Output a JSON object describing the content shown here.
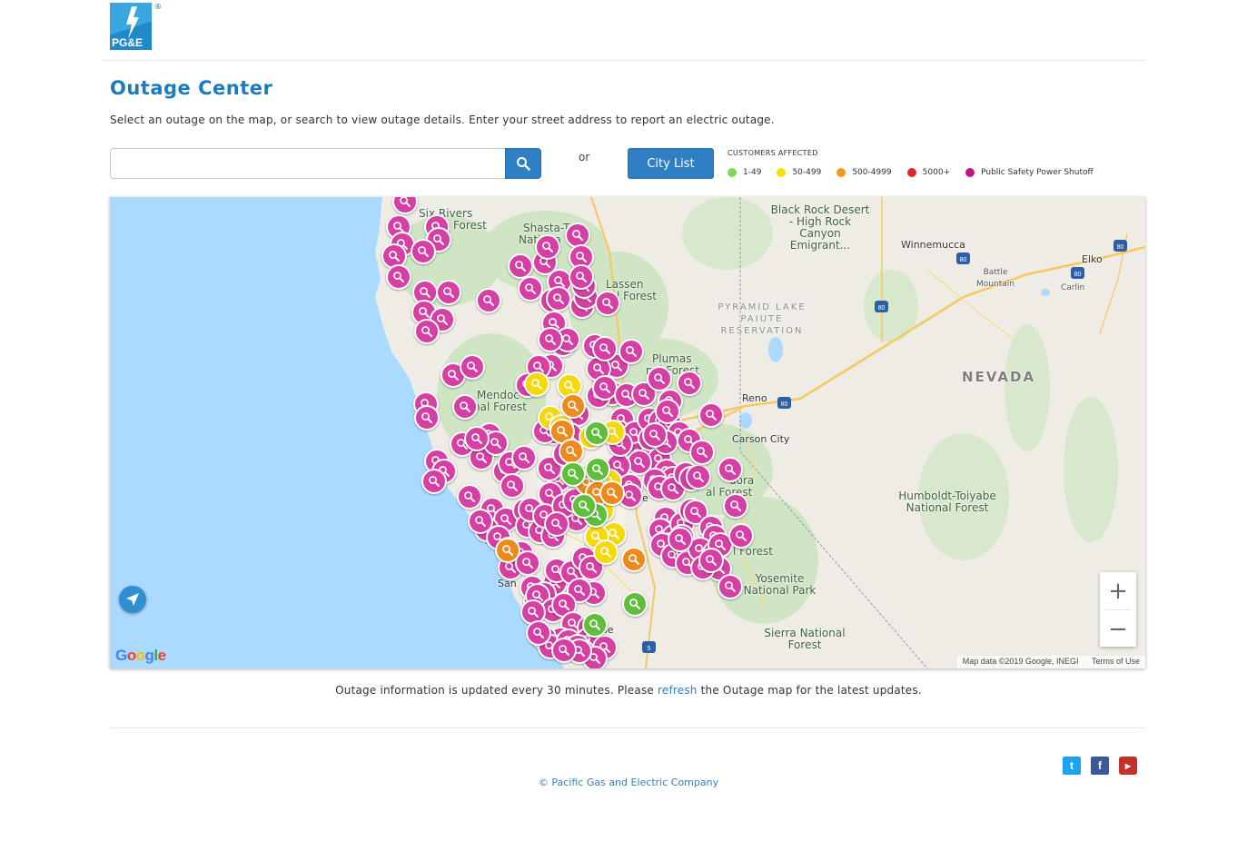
{
  "header": {
    "logo_text": "PG&E",
    "registered_mark": "®"
  },
  "page": {
    "title": "Outage Center",
    "intro": "Select an outage on the map, or search to view outage details. Enter your street address to report an electric outage."
  },
  "search": {
    "value": "",
    "placeholder": "",
    "or_label": "or",
    "city_list_label": "City List",
    "icon": "search-icon"
  },
  "legend": {
    "title": "CUSTOMERS AFFECTED",
    "items": [
      {
        "label": "1-49",
        "color": "#7ed957"
      },
      {
        "label": "50-499",
        "color": "#f5e003"
      },
      {
        "label": "500-4999",
        "color": "#f7941d"
      },
      {
        "label": "5000+",
        "color": "#e3262b"
      },
      {
        "label": "Public Safety Power Shutoff",
        "color": "#c6118b"
      }
    ]
  },
  "map": {
    "labels": {
      "six_rivers": "Six Rivers",
      "forest1": "Forest",
      "shasta": "Shasta-T",
      "national": "Nationa",
      "lassen": "Lassen",
      "lassen_forest": "nal Forest",
      "black_rock": "Black Rock Desert - High Rock Canyon Emigrant...",
      "winnemucca": "Winnemucca",
      "battle_mountain": "Battle Mountain",
      "elko": "Elko",
      "carlin": "Carlin",
      "pyramid": "PYRAMID LAKE PAIUTE RESERVATION",
      "plumas": "Plumas",
      "plumas_forest": "nal Forest",
      "nevada": "NEVADA",
      "mendocino": "Mendoc",
      "mendocino_forest": "nal Forest",
      "reno": "Reno",
      "carson": "Carson City",
      "humboldt": "Humboldt-Toiyabe National Forest",
      "eldorado": "dora",
      "eldorado_forest": "al Forest",
      "sacramento": "ente",
      "stanislaus_forest": "l Forest",
      "stanislaus": "us",
      "yosemite": "Yosemite National Park",
      "sierra": "Sierra National Forest",
      "san": "San",
      "se": "se"
    },
    "highways": [
      "80",
      "80",
      "80",
      "80",
      "80",
      "5"
    ],
    "marker_colors": {
      "pink": "#d63fa3",
      "yellow": "#f5d90a",
      "orange": "#ee8a1c",
      "green": "#5fbf3c"
    },
    "marker_icon": "magnifier-icon",
    "google_logo": "Google",
    "attribution": "Map data ©2019 Google, INEGI",
    "terms": "Terms of Use",
    "zoom_in": "+",
    "zoom_out": "−"
  },
  "notice": {
    "before": "Outage information is updated every 30 minutes. Please ",
    "link": "refresh",
    "after": " the Outage map for the latest updates."
  },
  "footer": {
    "copyright": "© Pacific Gas and Electric Company",
    "social": [
      {
        "name": "twitter",
        "color": "#1da1f2",
        "glyph": "t"
      },
      {
        "name": "facebook",
        "color": "#3b5998",
        "glyph": "f"
      },
      {
        "name": "youtube",
        "color": "#c4302b",
        "glyph": "▶"
      }
    ]
  }
}
